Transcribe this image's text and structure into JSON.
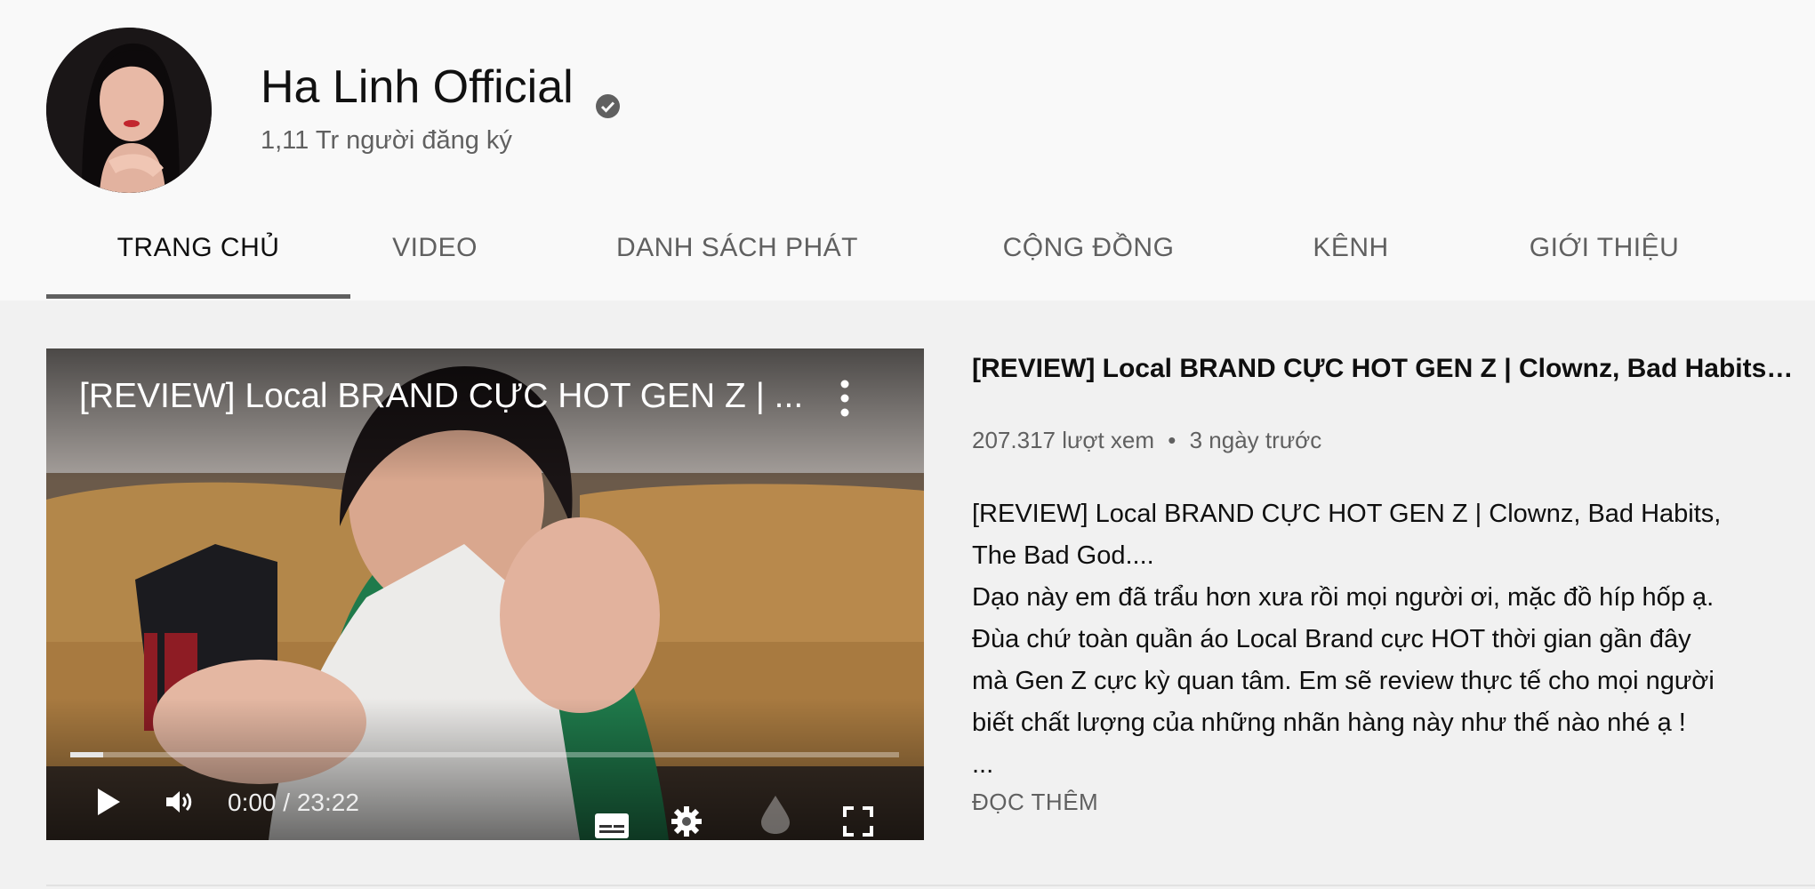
{
  "channel": {
    "name": "Ha Linh Official",
    "subscribers": "1,11 Tr người đăng ký"
  },
  "tabs": [
    {
      "label": "TRANG CHỦ",
      "active": true
    },
    {
      "label": "VIDEO",
      "active": false
    },
    {
      "label": "DANH SÁCH PHÁT",
      "active": false
    },
    {
      "label": "CỘNG ĐỒNG",
      "active": false
    },
    {
      "label": "KÊNH",
      "active": false
    },
    {
      "label": "GIỚI THIỆU",
      "active": false
    }
  ],
  "player": {
    "title": "[REVIEW] Local BRAND CỰC HOT GEN Z | ...",
    "time": "0:00 / 23:22",
    "progress_fraction": 0.0,
    "icons": [
      "more-vert-icon",
      "play-icon",
      "volume-icon",
      "subtitles-icon",
      "settings-icon",
      "watermark-icon",
      "fullscreen-icon"
    ]
  },
  "featured": {
    "title": "[REVIEW] Local BRAND CỰC HOT GEN Z | Clownz, Bad Habits, ...",
    "views": "207.317 lượt xem",
    "separator": "•",
    "age": "3 ngày trước",
    "description_lines": [
      "[REVIEW] Local BRAND CỰC HOT GEN Z | Clownz, Bad Habits,",
      "The Bad God....",
      "Dạo này em đã trẩu hơn xưa rồi mọi người ơi, mặc đồ híp hốp ạ.",
      "Đùa chứ toàn quần áo Local Brand cực HOT thời gian gần đây",
      "mà Gen Z cực kỳ quan tâm. Em sẽ review thực tế cho mọi người",
      "biết chất lượng của những nhãn hàng này như thế nào nhé ạ !",
      "..."
    ],
    "read_more": "ĐỌC THÊM"
  },
  "colors": {
    "header_bg": "#f9f9f9",
    "page_bg": "#f1f1f1",
    "secondary_text": "#606060"
  }
}
